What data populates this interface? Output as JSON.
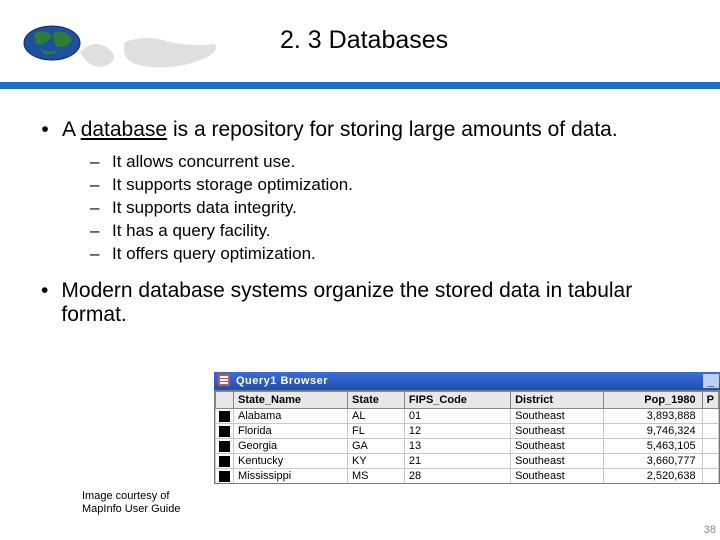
{
  "header": {
    "title": "2. 3 Databases"
  },
  "bullets": {
    "b1_pre": "A ",
    "b1_u": "database",
    "b1_post": " is a repository for storing large amounts of data.",
    "sub": [
      "It allows concurrent use.",
      "It supports storage optimization.",
      "It supports data integrity.",
      "It has a query facility.",
      "It offers query optimization."
    ],
    "b2": "Modern database systems organize the stored data in tabular format."
  },
  "credit": {
    "line1": "Image courtesy of",
    "line2": "MapInfo User Guide"
  },
  "browser": {
    "title": "Query1 Browser",
    "columns": {
      "state_name": "State_Name",
      "state": "State",
      "fips": "FIPS_Code",
      "district": "District",
      "pop1980": "Pop_1980",
      "p": "P"
    },
    "rows": [
      {
        "state_name": "Alabama",
        "state": "AL",
        "fips": "01",
        "district": "Southeast",
        "pop1980": "3,893,888"
      },
      {
        "state_name": "Florida",
        "state": "FL",
        "fips": "12",
        "district": "Southeast",
        "pop1980": "9,746,324"
      },
      {
        "state_name": "Georgia",
        "state": "GA",
        "fips": "13",
        "district": "Southeast",
        "pop1980": "5,463,105"
      },
      {
        "state_name": "Kentucky",
        "state": "KY",
        "fips": "21",
        "district": "Southeast",
        "pop1980": "3,660,777"
      },
      {
        "state_name": "Mississippi",
        "state": "MS",
        "fips": "28",
        "district": "Southeast",
        "pop1980": "2,520,638"
      }
    ]
  },
  "page_number": "38"
}
